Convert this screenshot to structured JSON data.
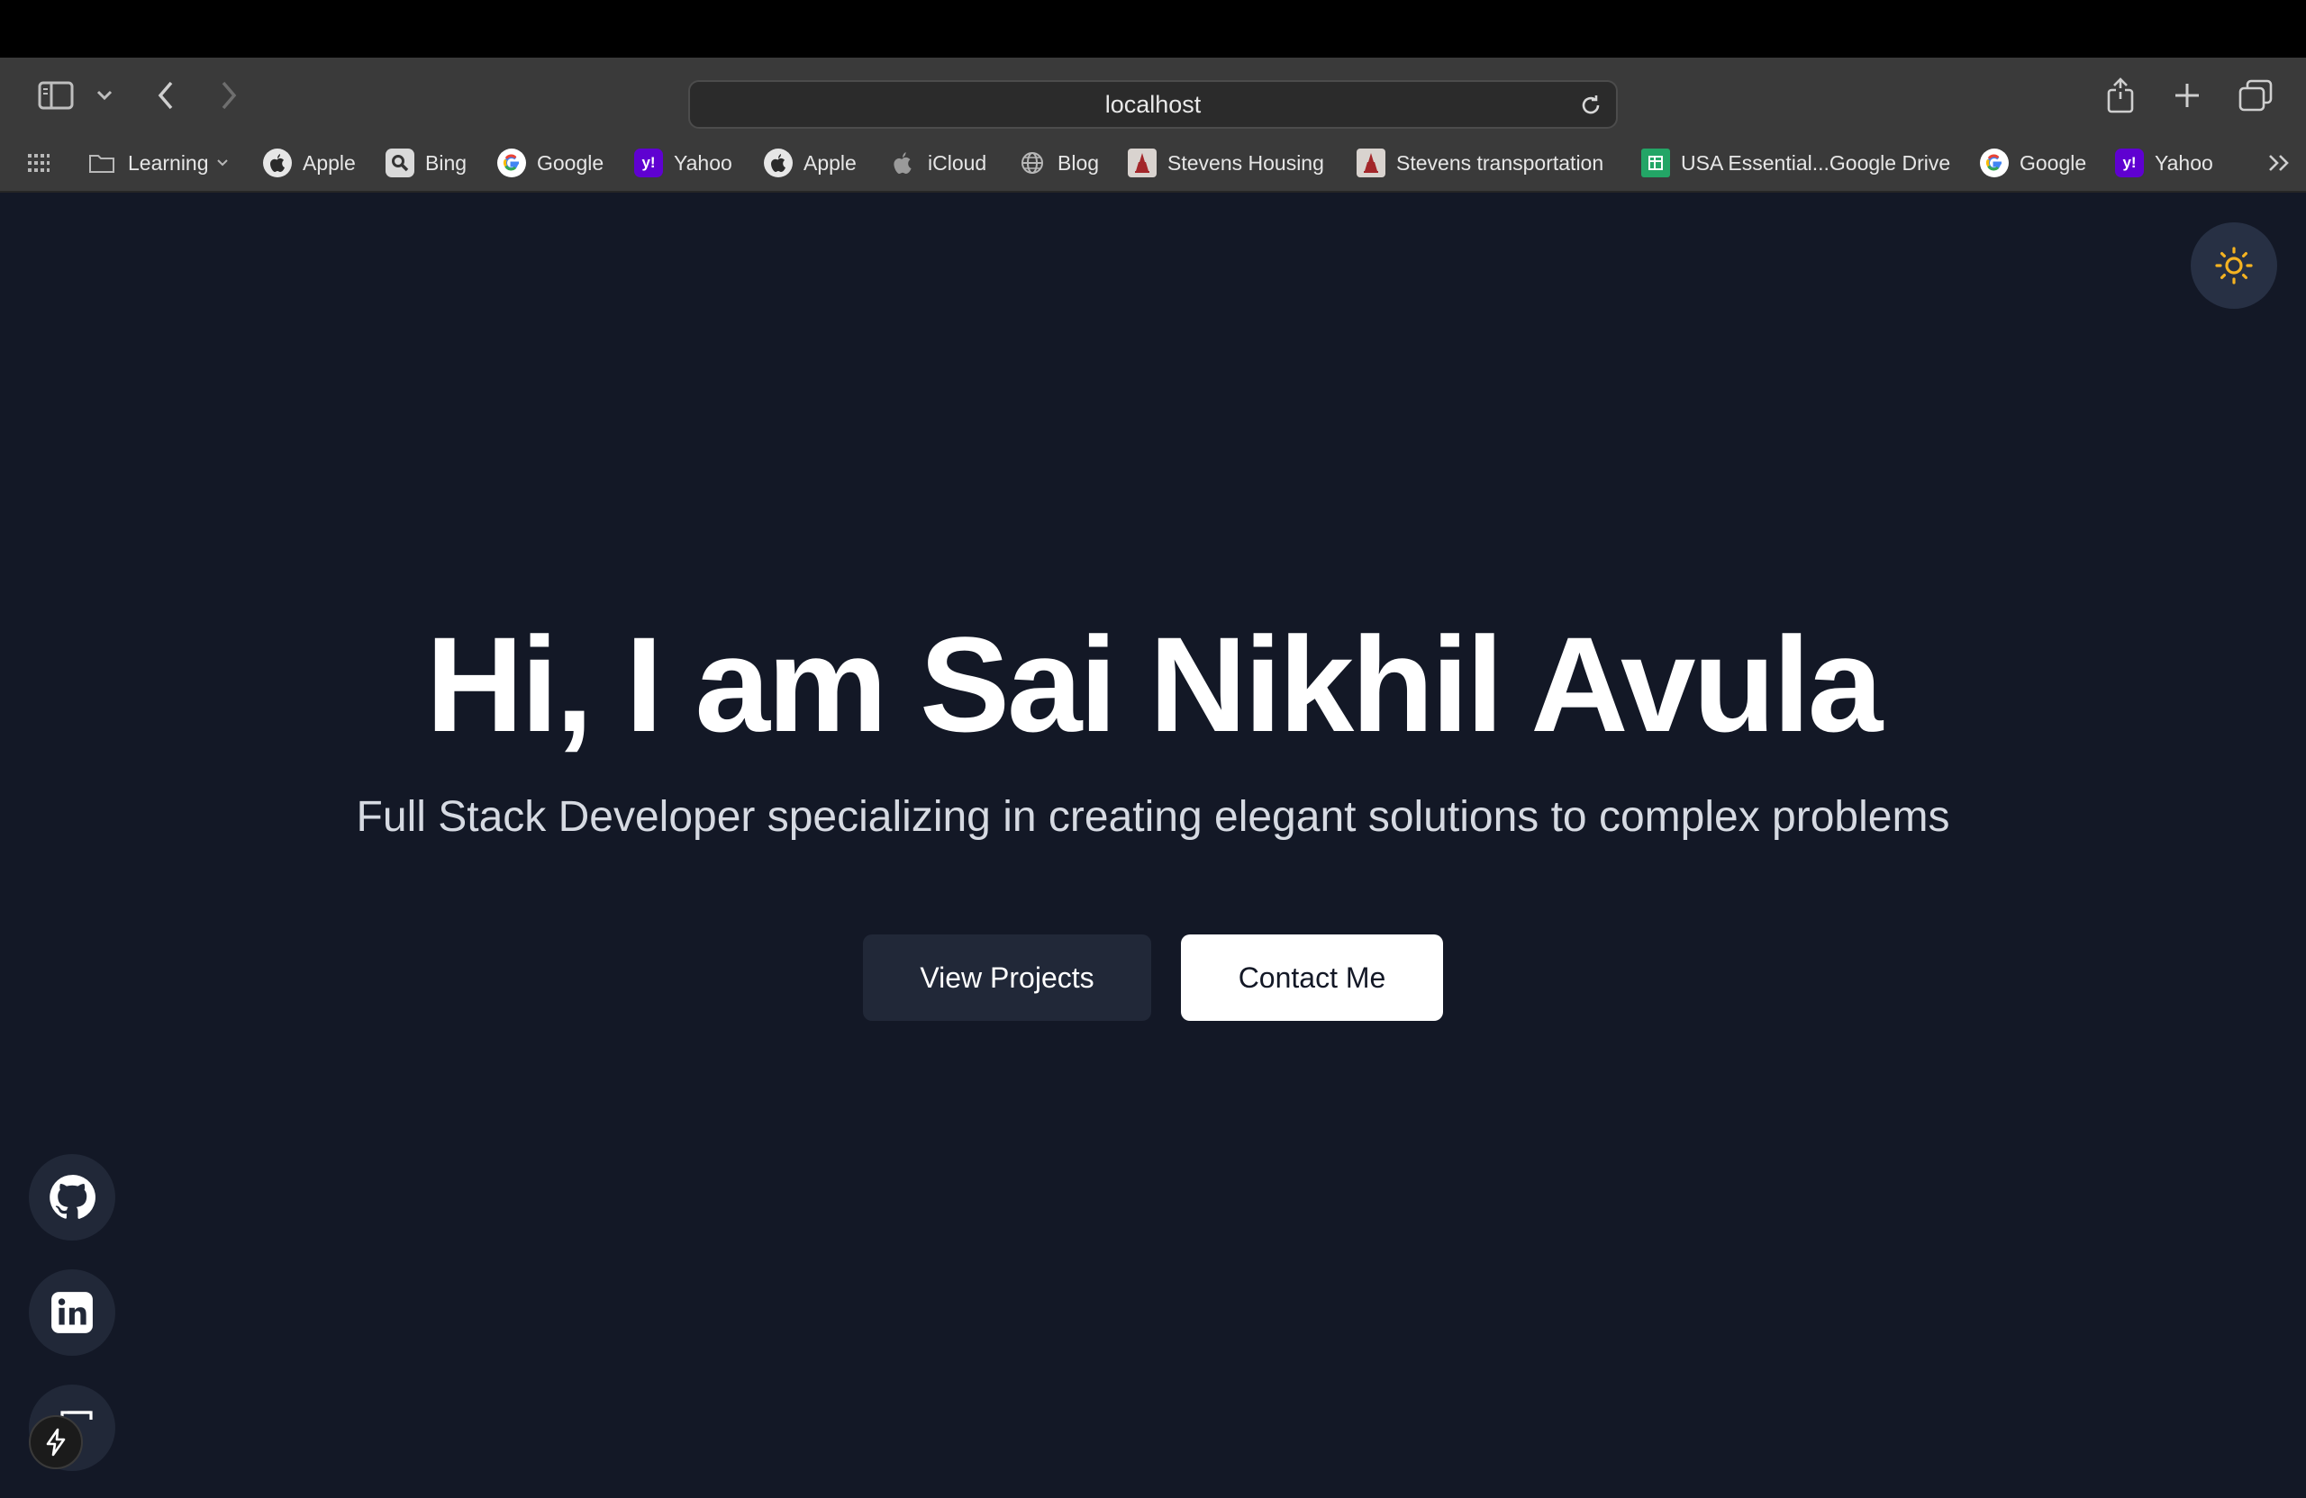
{
  "browser": {
    "address": "localhost",
    "bookmarks": [
      {
        "label": "Learning",
        "icon": "folder-icon"
      },
      {
        "label": "Apple",
        "icon": "apple-icon"
      },
      {
        "label": "Bing",
        "icon": "bing-icon"
      },
      {
        "label": "Google",
        "icon": "google-icon"
      },
      {
        "label": "Yahoo",
        "icon": "yahoo-icon"
      },
      {
        "label": "Apple",
        "icon": "apple-icon"
      },
      {
        "label": "iCloud",
        "icon": "icloud-icon"
      },
      {
        "label": "Blog",
        "icon": "globe-icon"
      },
      {
        "label": "Stevens Housing",
        "icon": "stevens-icon"
      },
      {
        "label": "Stevens transportation",
        "icon": "stevens-icon"
      },
      {
        "label": "USA Essential...Google Drive",
        "icon": "sheets-icon"
      },
      {
        "label": "Google",
        "icon": "google-icon"
      },
      {
        "label": "Yahoo",
        "icon": "yahoo-icon"
      }
    ]
  },
  "hero": {
    "title": "Hi, I am Sai Nikhil Avula",
    "subtitle": "Full Stack Developer specializing in creating elegant solutions to complex problems",
    "view_projects_label": "View Projects",
    "contact_label": "Contact Me"
  },
  "social": [
    "github-icon",
    "linkedin-icon",
    "portfolio-icon"
  ],
  "colors": {
    "page_bg": "#131826",
    "button_dark": "#212838",
    "button_light": "#ffffff",
    "sun_accent": "#f5b321"
  }
}
